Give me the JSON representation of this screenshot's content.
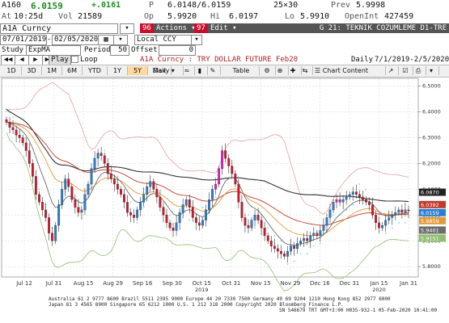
{
  "quote": {
    "ticker": "A160",
    "last": "6.0159",
    "change": "+.0161",
    "prefix_p": "P",
    "bid_ask": "6.0148/6.0159",
    "size": "25×30",
    "prev_label": "Prev",
    "prev": "5.9998",
    "at_label": "At",
    "time": "10:25d",
    "vol_label": "Vol",
    "vol": "21589",
    "op_label": "Op",
    "open": "5.9920",
    "hi_label": "Hi",
    "high": "6.0197",
    "lo_label": "Lo",
    "low": "5.9910",
    "oi_label": "OpenInt",
    "open_int": "427459"
  },
  "row3": {
    "security": "A1A Curncy",
    "actions_num": "96",
    "actions": "Actions ▾",
    "edit_num": "97",
    "edit": "Edit ▾",
    "title": "G 21: TEKNIK COZUMLEME D1-TRE"
  },
  "row4": {
    "start": "07/01/2019",
    "end": "02/05/2020",
    "currency": "Local CCY"
  },
  "row5": {
    "study_label": "Study",
    "study": "ExpMA",
    "period_label": "Period",
    "period": "50",
    "offset_label": "Offset",
    "offset": "0"
  },
  "row6": {
    "play": "Play",
    "loop": "Loop",
    "chart_name": "A1A Curncy : TRY DOLLAR FUTURE Feb20",
    "frequency": "Daily",
    "range": "7/1/2019-2/5/2020"
  },
  "toolbar": {
    "periods": [
      "1D",
      "3D",
      "1M",
      "6M",
      "YTD",
      "1Y",
      "5Y",
      "Max"
    ],
    "selected": "5Y",
    "freq": "Daily ▾",
    "table": "Table",
    "chart_content": "Chart Content"
  },
  "colors": {
    "bull": "#2a7fd4",
    "bear": "#d9142c",
    "alt": "#e020c0",
    "sma": "#333333",
    "ema": "#c0392b",
    "ema2": "#e39a3b",
    "ema3": "#6b6b6b",
    "bb_up": "#e8a0a0",
    "bb_low": "#8fbf6f",
    "sar": "#7fd4d4",
    "grid": "#d9d9d9"
  },
  "chart_data": {
    "type": "candlestick",
    "ylim": [
      5.76,
      6.53
    ],
    "yticks": [
      "6.5000",
      "6.4000",
      "6.3000",
      "6.2000",
      "6.1000",
      "6.0000",
      "5.9000",
      "5.8000"
    ],
    "xtick_labels": [
      "Jul 12",
      "Jul 31",
      "Aug 15",
      "Aug 29",
      "Sep 16",
      "Sep 30",
      "Oct 15",
      "Oct 31",
      "Nov 15",
      "Nov 29",
      "Dec 16",
      "Dec 31",
      "Jan 15",
      "Jan 31"
    ],
    "year_labels": [
      "2019",
      "2020"
    ],
    "closes": [
      6.36,
      6.34,
      6.33,
      6.31,
      6.3,
      6.28,
      6.25,
      6.2,
      6.15,
      6.08,
      6.05,
      6.02,
      5.99,
      5.93,
      5.9,
      5.96,
      6.04,
      6.1,
      6.14,
      6.11,
      6.06,
      6.03,
      6.01,
      6.02,
      6.08,
      6.12,
      6.18,
      6.22,
      6.24,
      6.23,
      6.2,
      6.16,
      6.14,
      6.12,
      6.1,
      6.08,
      6.05,
      6.01,
      6.0,
      5.99,
      6.02,
      6.05,
      6.08,
      6.11,
      6.13,
      6.1,
      6.07,
      6.03,
      6.0,
      5.97,
      5.95,
      5.94,
      5.97,
      6.01,
      6.04,
      6.06,
      6.03,
      5.99,
      5.97,
      5.96,
      5.98,
      6.02,
      6.06,
      6.1,
      6.12,
      6.18,
      6.25,
      6.22,
      6.19,
      6.16,
      6.12,
      6.05,
      5.99,
      5.96,
      5.95,
      5.98,
      6.0,
      5.98,
      5.95,
      5.92,
      5.9,
      5.88,
      5.87,
      5.86,
      5.85,
      5.84,
      5.86,
      5.88,
      5.87,
      5.89,
      5.9,
      5.91,
      5.9,
      5.92,
      5.93,
      5.92,
      5.94,
      5.96,
      5.99,
      6.02,
      6.05,
      6.06,
      6.05,
      6.06,
      6.07,
      6.08,
      6.09,
      6.08,
      6.07,
      6.06,
      6.05,
      6.04,
      6.0,
      5.97,
      5.95,
      5.96,
      5.98,
      5.99,
      6.0,
      6.01,
      6.02,
      6.01,
      6.02,
      6.016
    ],
    "last_values": {
      "sma200": "6.0870",
      "ema_a": "6.0392",
      "last": "6.0159",
      "ema_b": "5.9859",
      "ema_c": "5.9401",
      "bb_low": "5.9151"
    }
  },
  "footer": {
    "line1": "Australia 61 2 9777 8600  Brazil 5511 2395 9000  Europe 44 20 7330 7500  Germany 49 69 9204 1210  Hong Kong 852 2977 6000",
    "line2": "Japan 81 3 4565 8900        Singapore 65 6212 1000        U.S. 1 212 318 2000        Copyright 2020 Bloomberg Finance L.P.",
    "line3": "SN 546679 TRT  GMT+3:00  H035-932-1  05-Feb-2020 10:41:00"
  }
}
